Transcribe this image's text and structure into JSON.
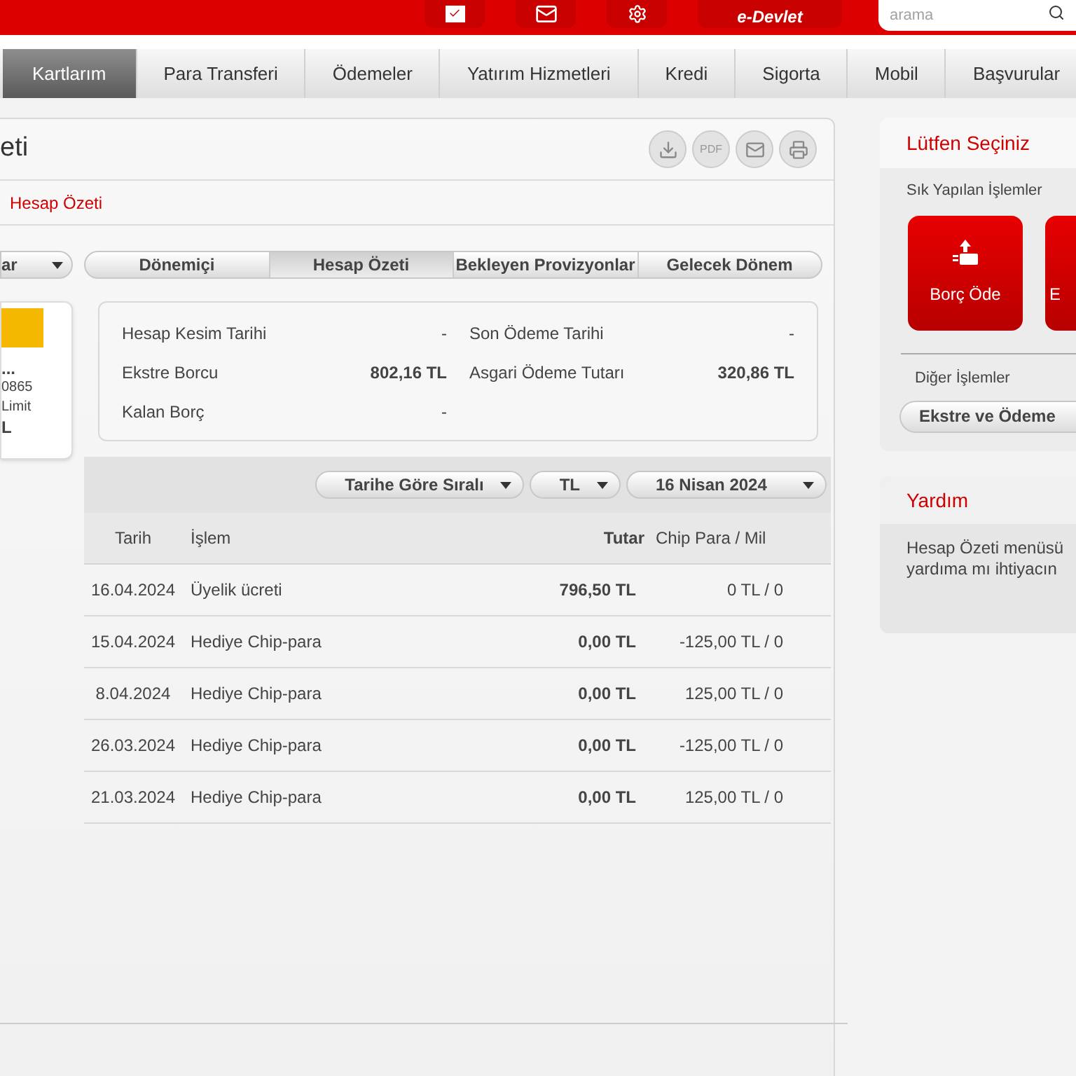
{
  "header": {
    "edevlet": "e-Devlet",
    "search": {
      "placeholder": "arama"
    }
  },
  "nav": [
    {
      "label": "Kartlarım",
      "selected": true
    },
    {
      "label": "Para Transferi",
      "selected": false
    },
    {
      "label": "Ödemeler",
      "selected": false
    },
    {
      "label": "Yatırım Hizmetleri",
      "selected": false
    },
    {
      "label": "Kredi",
      "selected": false
    },
    {
      "label": "Sigorta",
      "selected": false
    },
    {
      "label": "Mobil",
      "selected": false
    },
    {
      "label": "Başvurular",
      "selected": false
    }
  ],
  "page": {
    "title": "eti",
    "pdf_label": "PDF",
    "breadcrumb": "Hesap Özeti"
  },
  "card_panel": {
    "dropdown": "ar",
    "lines": [
      "...",
      "0865",
      "Limit",
      "L"
    ]
  },
  "tabs": [
    {
      "label": "Dönemiçi",
      "selected": false
    },
    {
      "label": "Hesap Özeti",
      "selected": true
    },
    {
      "label": "Bekleyen Provizyonlar",
      "selected": false
    },
    {
      "label": "Gelecek Dönem",
      "selected": false
    }
  ],
  "summary": [
    {
      "label": "Hesap Kesim Tarihi",
      "value": "-"
    },
    {
      "label": "Son Ödeme Tarihi",
      "value": "-"
    },
    {
      "label": "Ekstre Borcu",
      "value": "802,16 TL"
    },
    {
      "label": "Asgari Ödeme Tutarı",
      "value": "320,86 TL"
    },
    {
      "label": "Kalan Borç",
      "value": "-"
    }
  ],
  "filters": [
    "Tarihe Göre Sıralı",
    "TL",
    "16 Nisan 2024"
  ],
  "table": {
    "columns": [
      "Tarih",
      "İşlem",
      "Tutar",
      "Chip Para / Mil"
    ],
    "rows": [
      [
        "16.04.2024",
        "Üyelik ücreti",
        "796,50 TL",
        "0 TL / 0"
      ],
      [
        "15.04.2024",
        "Hediye Chip-para",
        "0,00 TL",
        "-125,00 TL / 0"
      ],
      [
        "8.04.2024",
        "Hediye Chip-para",
        "0,00 TL",
        "125,00 TL / 0"
      ],
      [
        "26.03.2024",
        "Hediye Chip-para",
        "0,00 TL",
        "-125,00 TL / 0"
      ],
      [
        "21.03.2024",
        "Hediye Chip-para",
        "0,00 TL",
        "125,00 TL / 0"
      ]
    ]
  },
  "sidebar": {
    "title": "Lütfen Seçiniz",
    "frequent_label": "Sık Yapılan İşlemler",
    "quick_actions": [
      "Borç Öde",
      "E"
    ],
    "other_label": "Diğer İşlemler",
    "other_button": "Ekstre ve Ödeme",
    "help_title": "Yardım",
    "help_lines": [
      "Hesap Özeti menüsü",
      "yardıma mı ihtiyacın"
    ]
  }
}
